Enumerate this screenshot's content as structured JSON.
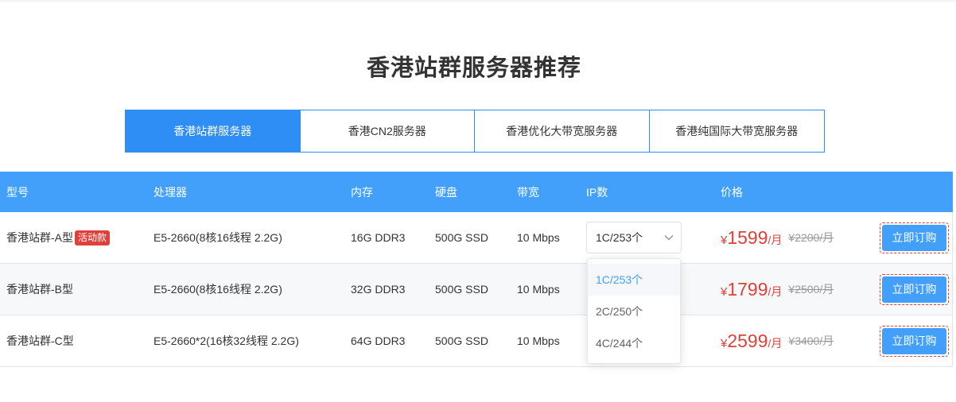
{
  "page_title": "香港站群服务器推荐",
  "tabs": [
    {
      "label": "香港站群服务器",
      "active": true
    },
    {
      "label": "香港CN2服务器",
      "active": false
    },
    {
      "label": "香港优化大带宽服务器",
      "active": false
    },
    {
      "label": "香港纯国际大带宽服务器",
      "active": false
    }
  ],
  "table": {
    "headers": {
      "model": "型号",
      "cpu": "处理器",
      "memory": "内存",
      "disk": "硬盘",
      "bandwidth": "带宽",
      "ip": "IP数",
      "price": "价格"
    },
    "rows": [
      {
        "model": "香港站群-A型",
        "badge": "活动款",
        "cpu": "E5-2660(8核16线程 2.2G)",
        "memory": "16G DDR3",
        "disk": "500G SSD",
        "bandwidth": "10 Mbps",
        "ip": "1C/253个",
        "yen": "¥",
        "price": "1599",
        "unit": "/月",
        "old_price": "¥2200/月",
        "buy": "立即订购"
      },
      {
        "model": "香港站群-B型",
        "badge": "",
        "cpu": "E5-2660(8核16线程 2.2G)",
        "memory": "32G DDR3",
        "disk": "500G SSD",
        "bandwidth": "10 Mbps",
        "ip": "",
        "yen": "¥",
        "price": "1799",
        "unit": "/月",
        "old_price": "¥2500/月",
        "buy": "立即订购"
      },
      {
        "model": "香港站群-C型",
        "badge": "",
        "cpu": "E5-2660*2(16核32线程 2.2G)",
        "memory": "64G DDR3",
        "disk": "500G SSD",
        "bandwidth": "10 Mbps",
        "ip": "",
        "yen": "¥",
        "price": "2599",
        "unit": "/月",
        "old_price": "¥3400/月",
        "buy": "立即订购"
      }
    ]
  },
  "ip_dropdown": {
    "options": [
      "1C/253个",
      "2C/250个",
      "4C/244个"
    ],
    "selected": "1C/253个"
  },
  "colors": {
    "accent": "#2e8ef5",
    "header": "#42a0fb",
    "price": "#e0403a"
  }
}
